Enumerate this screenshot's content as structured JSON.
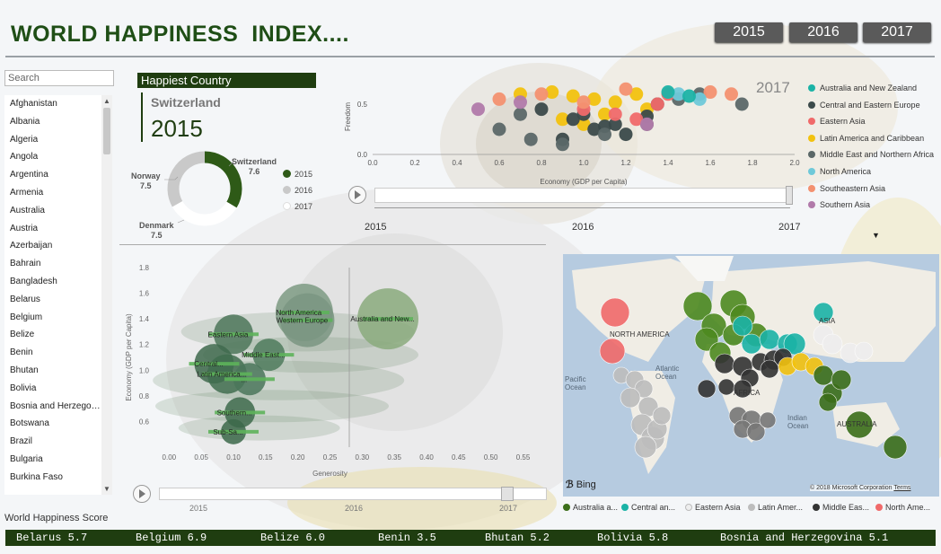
{
  "header": {
    "title": "WORLD HAPPINESS  INDEX....",
    "year_buttons": [
      "2015",
      "2016",
      "2017"
    ]
  },
  "sidebar": {
    "search_placeholder": "Search",
    "countries": [
      "Afghanistan",
      "Albania",
      "Algeria",
      "Angola",
      "Argentina",
      "Armenia",
      "Australia",
      "Austria",
      "Azerbaijan",
      "Bahrain",
      "Bangladesh",
      "Belarus",
      "Belgium",
      "Belize",
      "Benin",
      "Bhutan",
      "Bolivia",
      "Bosnia and Herzegov...",
      "Botswana",
      "Brazil",
      "Bulgaria",
      "Burkina Faso"
    ]
  },
  "happiest": {
    "header": "Happiest Country",
    "country": "Switzerland",
    "year": "2015"
  },
  "donut": {
    "slices": [
      {
        "country": "Switzerland",
        "score": "7.6",
        "color": "#2e5a17",
        "value": 7.6
      },
      {
        "country": "Norway",
        "score": "7.5",
        "color": "#ffffff",
        "value": 7.5
      },
      {
        "country": "Denmark",
        "score": "7.5",
        "color": "#c9c9c9",
        "value": 7.5
      }
    ],
    "legend": [
      {
        "label": "2015",
        "color": "#2e5a17"
      },
      {
        "label": "2016",
        "color": "#c9c9c9"
      },
      {
        "label": "2017",
        "color": "#ffffff"
      }
    ]
  },
  "scatter_top": {
    "year_overlay": "2017",
    "ylabel": "Freedom",
    "xlabel": "Economy (GDP per Capita)",
    "xticks": [
      "0.0",
      "0.2",
      "0.4",
      "0.6",
      "0.8",
      "1.0",
      "1.2",
      "1.4",
      "1.6",
      "1.8",
      "2.0"
    ],
    "yticks": [
      "0.5",
      "0.0"
    ],
    "play_years": [
      "2015",
      "2016",
      "2017"
    ],
    "legend": [
      {
        "label": "Australia and New Zealand",
        "color": "#1bb3a6"
      },
      {
        "label": "Central and Eastern Europe",
        "color": "#3b4a4a"
      },
      {
        "label": "Eastern Asia",
        "color": "#f06a6a"
      },
      {
        "label": "Latin America and Caribbean",
        "color": "#f2c20f"
      },
      {
        "label": "Middle East and Northern Africa",
        "color": "#5b6868"
      },
      {
        "label": "North America",
        "color": "#6fc9d9"
      },
      {
        "label": "Southeastern Asia",
        "color": "#f39170"
      },
      {
        "label": "Southern Asia",
        "color": "#b17aaa"
      }
    ]
  },
  "chart_data": [
    {
      "type": "scatter",
      "title": "",
      "xlabel": "Economy (GDP per Capita)",
      "ylabel": "Freedom",
      "xlim": [
        0,
        2.0
      ],
      "ylim": [
        0,
        0.75
      ],
      "series": [
        {
          "name": "Latin America and Caribbean",
          "color": "#f2c20f",
          "x": [
            0.7,
            0.85,
            0.95,
            1.05,
            1.15,
            1.25,
            1.3,
            1.1,
            0.9,
            1.0
          ],
          "y": [
            0.6,
            0.62,
            0.58,
            0.55,
            0.52,
            0.6,
            0.45,
            0.4,
            0.35,
            0.3
          ]
        },
        {
          "name": "Central and Eastern Europe",
          "color": "#3b4a4a",
          "x": [
            0.8,
            0.95,
            1.05,
            1.15,
            1.2,
            1.3,
            1.35,
            0.9,
            1.0,
            1.1
          ],
          "y": [
            0.45,
            0.35,
            0.25,
            0.3,
            0.2,
            0.38,
            0.5,
            0.15,
            0.4,
            0.28
          ]
        },
        {
          "name": "Middle East and Northern Africa",
          "color": "#5b6868",
          "x": [
            0.6,
            0.75,
            0.9,
            1.1,
            1.3,
            1.45,
            1.55,
            1.75,
            0.7
          ],
          "y": [
            0.25,
            0.15,
            0.1,
            0.2,
            0.3,
            0.55,
            0.6,
            0.5,
            0.4
          ]
        },
        {
          "name": "Eastern Asia",
          "color": "#f06a6a",
          "x": [
            1.0,
            1.15,
            1.25,
            1.35,
            1.4
          ],
          "y": [
            0.45,
            0.4,
            0.35,
            0.5,
            0.6
          ]
        },
        {
          "name": "Southeastern Asia",
          "color": "#f39170",
          "x": [
            0.6,
            0.8,
            1.0,
            1.2,
            1.6,
            1.7
          ],
          "y": [
            0.55,
            0.6,
            0.52,
            0.65,
            0.62,
            0.6
          ]
        },
        {
          "name": "Southern Asia",
          "color": "#b17aaa",
          "x": [
            0.5,
            0.7,
            1.3
          ],
          "y": [
            0.45,
            0.52,
            0.3
          ]
        },
        {
          "name": "North America",
          "color": "#6fc9d9",
          "x": [
            1.45,
            1.55
          ],
          "y": [
            0.6,
            0.55
          ]
        },
        {
          "name": "Australia and New Zealand",
          "color": "#1bb3a6",
          "x": [
            1.4,
            1.5
          ],
          "y": [
            0.62,
            0.58
          ]
        }
      ]
    },
    {
      "type": "scatter",
      "title": "",
      "xlabel": "Generosity",
      "ylabel": "Economy (GDP per Capita)",
      "xlim": [
        -0.02,
        0.58
      ],
      "ylim": [
        0.4,
        1.8
      ],
      "xticks": [
        "0.00",
        "0.05",
        "0.10",
        "0.15",
        "0.20",
        "0.25",
        "0.30",
        "0.35",
        "0.40",
        "0.45",
        "0.50",
        "0.55"
      ],
      "yticks": [
        "1.8",
        "1.6",
        "1.4",
        "1.2",
        "1.0",
        "0.8",
        "0.6"
      ],
      "play_years": [
        "2015",
        "2016",
        "2017"
      ],
      "points": [
        {
          "label": "North America",
          "x": 0.21,
          "y": 1.45,
          "r": 32,
          "color": "#7d9a82"
        },
        {
          "label": "Western Europe",
          "x": 0.215,
          "y": 1.39,
          "r": 30,
          "color": "#7a9581"
        },
        {
          "label": "Australia and New...",
          "x": 0.34,
          "y": 1.4,
          "r": 34,
          "color": "#8aaa7d"
        },
        {
          "label": "Eastern Asia",
          "x": 0.1,
          "y": 1.28,
          "r": 22,
          "color": "#4c7559"
        },
        {
          "label": "Middle East...",
          "x": 0.155,
          "y": 1.12,
          "r": 18,
          "color": "#4e7a5c"
        },
        {
          "label": "Central...",
          "x": 0.07,
          "y": 1.05,
          "r": 22,
          "color": "#3f6a4d"
        },
        {
          "label": "Latin America...",
          "x": 0.09,
          "y": 0.97,
          "r": 22,
          "color": "#416d4f"
        },
        {
          "label": "...",
          "x": 0.125,
          "y": 0.93,
          "r": 18,
          "color": "#4a765a"
        },
        {
          "label": "Southern...",
          "x": 0.11,
          "y": 0.67,
          "r": 17,
          "color": "#3d6a4b"
        },
        {
          "label": "Sub-Sa...",
          "x": 0.1,
          "y": 0.52,
          "r": 14,
          "color": "#3c684a"
        }
      ]
    }
  ],
  "bottom_scatter": {
    "xlabel": "Generosity",
    "ylabel": "Economy (GDP per Capita)"
  },
  "map": {
    "labels": [
      "NORTH AMERICA",
      "ASIA",
      "AFRICA",
      "AUSTRALIA",
      "Atlantic Ocean",
      "Indian Ocean",
      "Pacific Ocean"
    ],
    "bing": "Bing",
    "copyright": "© 2018 Microsoft Corporation",
    "terms": "Terms",
    "legend": [
      {
        "label": "Australia a...",
        "color": "#3b6e1a"
      },
      {
        "label": "Central an...",
        "color": "#1bb3a6"
      },
      {
        "label": "Eastern Asia",
        "color": "#eeeeee"
      },
      {
        "label": "Latin Amer...",
        "color": "#bdbdbd"
      },
      {
        "label": "Middle Eas...",
        "color": "#333333"
      },
      {
        "label": "North Ame...",
        "color": "#f06a6a"
      }
    ]
  },
  "score": {
    "label": "World Happiness Score",
    "ticker": [
      "Belarus 5.7",
      "Belgium 6.9",
      "Belize 6.0",
      "Benin 3.5",
      "Bhutan 5.2",
      "Bolivia 5.8",
      "Bosnia and Herzegovina 5.1"
    ]
  }
}
